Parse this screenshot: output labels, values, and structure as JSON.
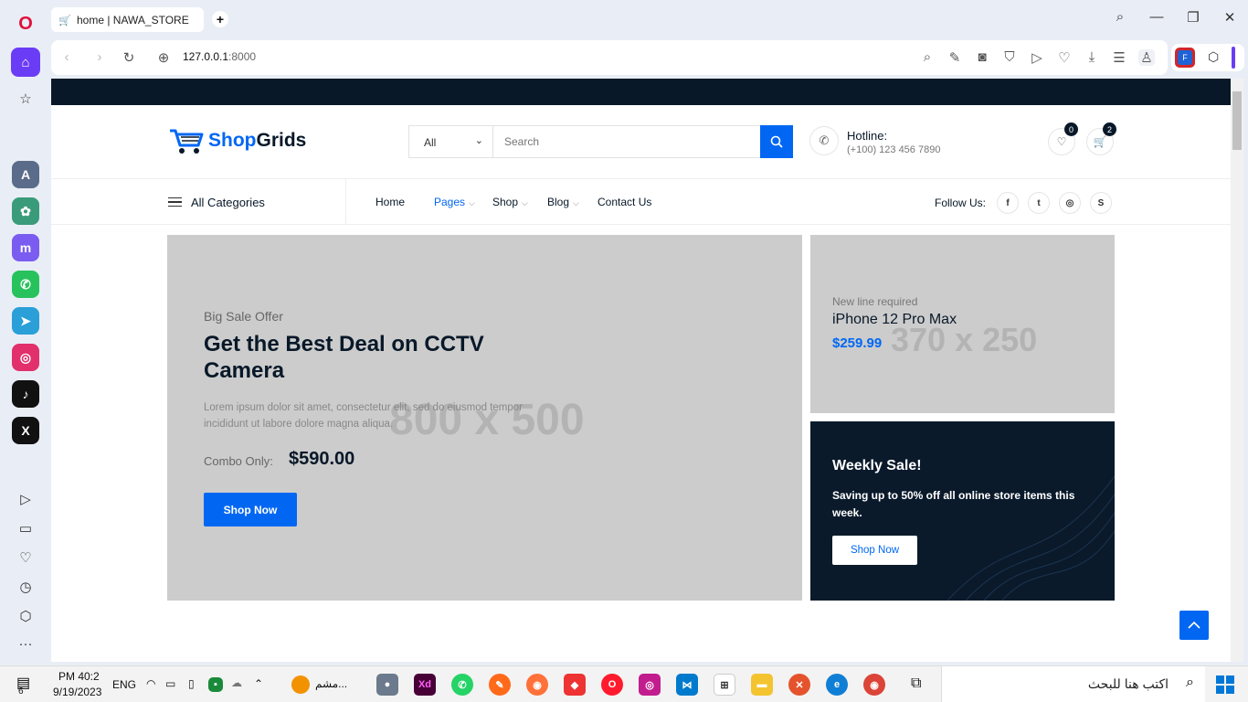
{
  "browser": {
    "tab_title": "home | NAWA_STORE",
    "url_host": "127.0.0.1",
    "url_port": ":8000"
  },
  "site": {
    "logo_part1": "Shop",
    "logo_part2": "Grids",
    "search": {
      "category": "All",
      "placeholder": "Search"
    },
    "hotline_label": "Hotline:",
    "hotline_number": "(+100) 123 456 7890",
    "wishlist_count": "0",
    "cart_count": "2",
    "all_categories": "All Categories",
    "nav": {
      "home": "Home",
      "pages": "Pages",
      "shop": "Shop",
      "blog": "Blog",
      "contact": "Contact Us"
    },
    "follow_us": "Follow Us:",
    "hero": {
      "placeholder": "800 x 500",
      "small_title": "Big Sale Offer",
      "title": "Get the Best Deal on CCTV Camera",
      "description": "Lorem ipsum dolor sit amet, consectetur elit, sed do eiusmod tempor incididunt ut labore dolore magna aliqua.",
      "combo_label": "Combo Only:",
      "combo_price": "$590.00",
      "button": "Shop Now"
    },
    "side_banner": {
      "placeholder": "370 x 250",
      "small_title": "New line required",
      "title": "iPhone 12 Pro Max",
      "price": "$259.99"
    },
    "weekly_sale": {
      "title": "Weekly Sale!",
      "text": "Saving up to 50% off all online store items this week.",
      "button": "Shop Now"
    }
  },
  "taskbar": {
    "search_placeholder": "اكتب هنا للبحث",
    "time": "PM 40:2",
    "date": "9/19/2023",
    "language": "ENG",
    "app_label": "مشم...",
    "notification_count": "6"
  },
  "colors": {
    "brand_blue": "#0167f3",
    "dark_navy": "#081828",
    "placeholder_gray": "#cccccc"
  }
}
